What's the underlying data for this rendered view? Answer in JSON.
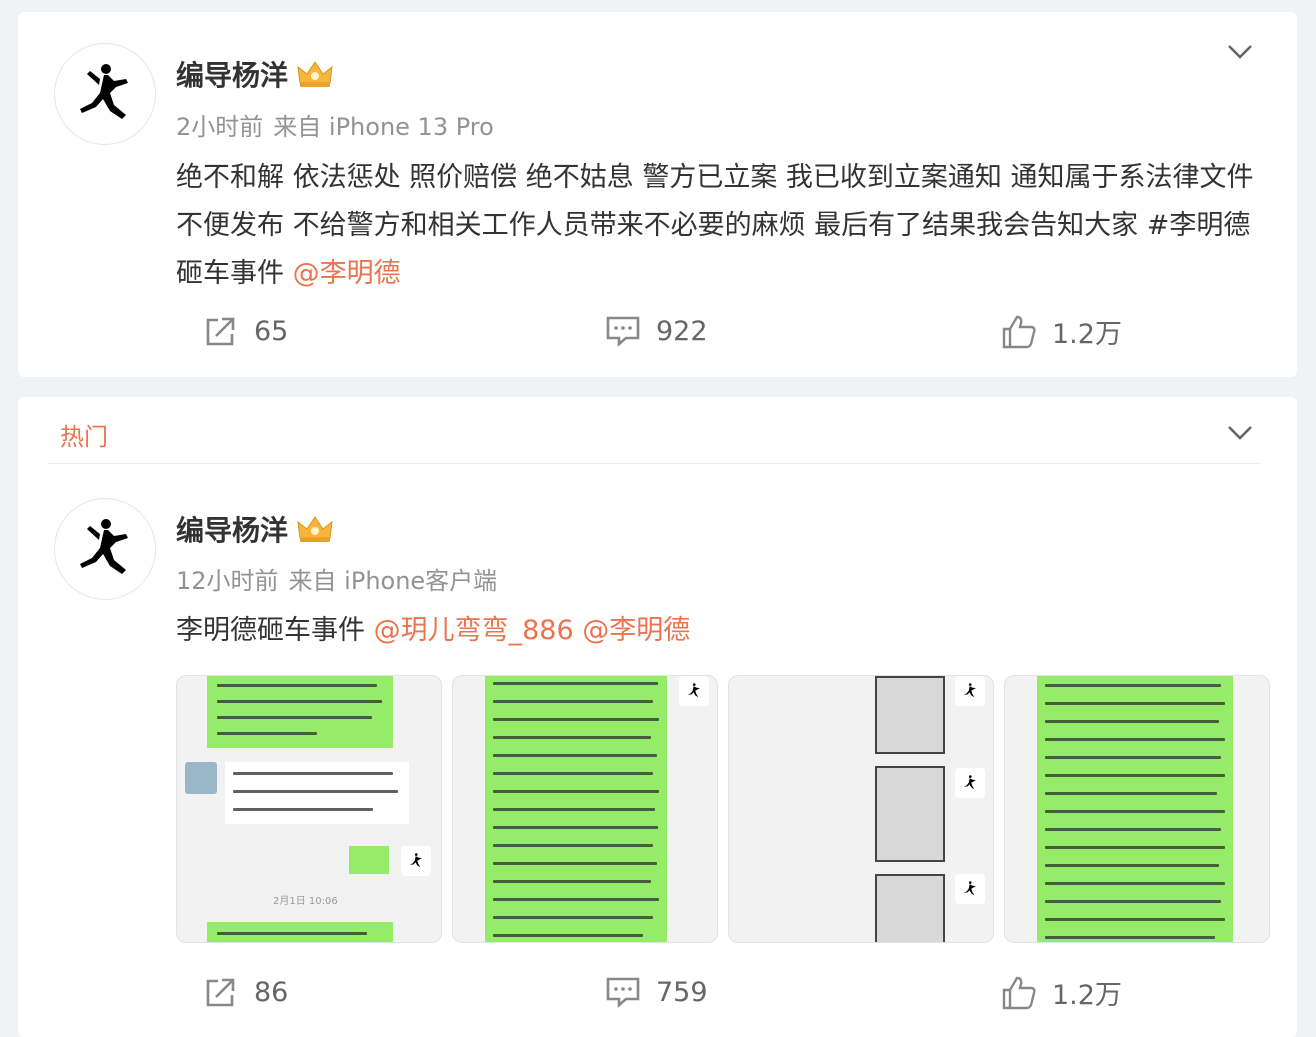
{
  "post1": {
    "author": "编导杨洋",
    "time": "2小时前",
    "source": "来自 iPhone 13 Pro",
    "text": "绝不和解 依法惩处 照价赔偿 绝不姑息 警方已立案 我已收到立案通知 通知属于系法律文件 不便发布 不给警方和相关工作人员带来不必要的麻烦 最后有了结果我会告知大家 ",
    "topic": "#李明德砸车事件",
    "mention": "@李明德",
    "reposts": "65",
    "comments": "922",
    "likes": "1.2万"
  },
  "post2": {
    "section_label": "热门",
    "author": "编导杨洋",
    "time": "12小时前",
    "source": "来自 iPhone客户端",
    "text": "李明德砸车事件 ",
    "mention1": "@玥儿弯弯_886",
    "mention2": "@李明德",
    "reposts": "86",
    "comments": "759",
    "likes": "1.2万",
    "images": [
      {
        "name": "chat-screenshot-1"
      },
      {
        "name": "chat-screenshot-2"
      },
      {
        "name": "chat-screenshot-3"
      },
      {
        "name": "chat-screenshot-4"
      }
    ]
  },
  "icons": {
    "avatar": "jumpman-logo-icon",
    "badge": "crown-badge-icon",
    "menu": "chevron-down-icon",
    "repost": "repost-icon",
    "comment": "comment-icon",
    "like": "thumbs-up-icon"
  },
  "colors": {
    "accent": "#eb7350",
    "text": "#333333",
    "meta": "#939393",
    "background": "#f1f2f5",
    "chat_green": "#95ec69"
  }
}
